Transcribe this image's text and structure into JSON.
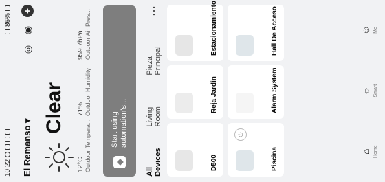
{
  "status": {
    "time": "10:22",
    "battery": "86%"
  },
  "home": {
    "name": "El Remanso ▾",
    "plus": "+"
  },
  "weather": {
    "state": "Clear",
    "temp": "12°C",
    "temp_label": "Outdoor Tempera...",
    "humidity": "71%",
    "humidity_label": "Outdoor Humidity",
    "pressure": "959.7hPa",
    "pressure_label": "Outdoor Air Pres..."
  },
  "automation_banner": {
    "line1": "Start using",
    "line2": "automation's..."
  },
  "tabs": [
    "All Devices",
    "Living Room",
    "Pieza Principal"
  ],
  "tabs_more": "⋯",
  "devices": [
    {
      "name": "D500",
      "icon": "robot-vacuum-icon"
    },
    {
      "name": "Piscina",
      "icon": "pool-icon"
    },
    {
      "name": "Reja Jardin",
      "icon": "gate-icon"
    },
    {
      "name": "Alarm System",
      "icon": "alarm-icon"
    },
    {
      "name": "Estacionamiento",
      "icon": "parking-icon"
    },
    {
      "name": "Hall De Acceso",
      "icon": "camera-icon"
    }
  ],
  "bottom_nav": [
    {
      "label": "Home",
      "icon": "home-icon"
    },
    {
      "label": "Smart",
      "icon": "smart-icon"
    },
    {
      "label": "Me",
      "icon": "me-icon"
    }
  ],
  "colors": {
    "background": "#f1f2f4",
    "card": "#ffffff",
    "banner": "#7e7e7e"
  }
}
